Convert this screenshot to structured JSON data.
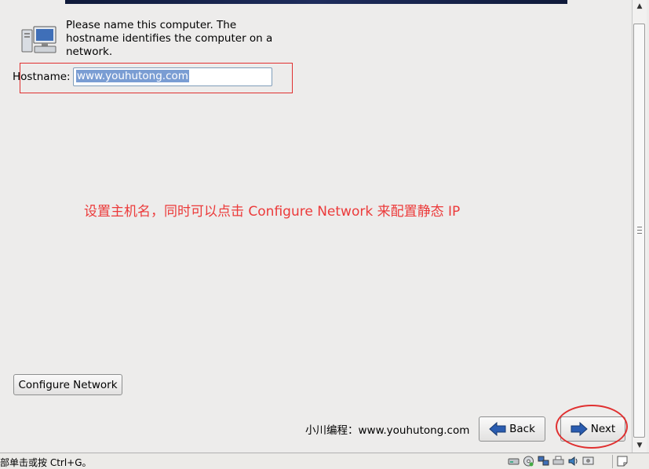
{
  "intro_text": "Please name this computer.  The hostname identifies the computer on a network.",
  "hostname": {
    "label": "Hostname:",
    "value": "www.youhutong.com"
  },
  "annotation": "设置主机名，同时可以点击 Configure Network 来配置静态 IP",
  "buttons": {
    "configure_network": "Configure Network",
    "back": "Back",
    "next": "Next"
  },
  "watermark": "小川编程：www.youhutong.com",
  "status_text": "部单击或按 Ctrl+G。",
  "colors": {
    "annotation": "#ec3a3a",
    "highlight": "#e03030",
    "selection": "#7a9dd3",
    "arrow": "#2a5cb0"
  },
  "icons": [
    "computer-icon",
    "back-arrow-icon",
    "next-arrow-icon",
    "hard-disk-icon",
    "cd-icon",
    "network-icon",
    "printer-icon",
    "sound-icon",
    "display-icon",
    "note-icon"
  ]
}
